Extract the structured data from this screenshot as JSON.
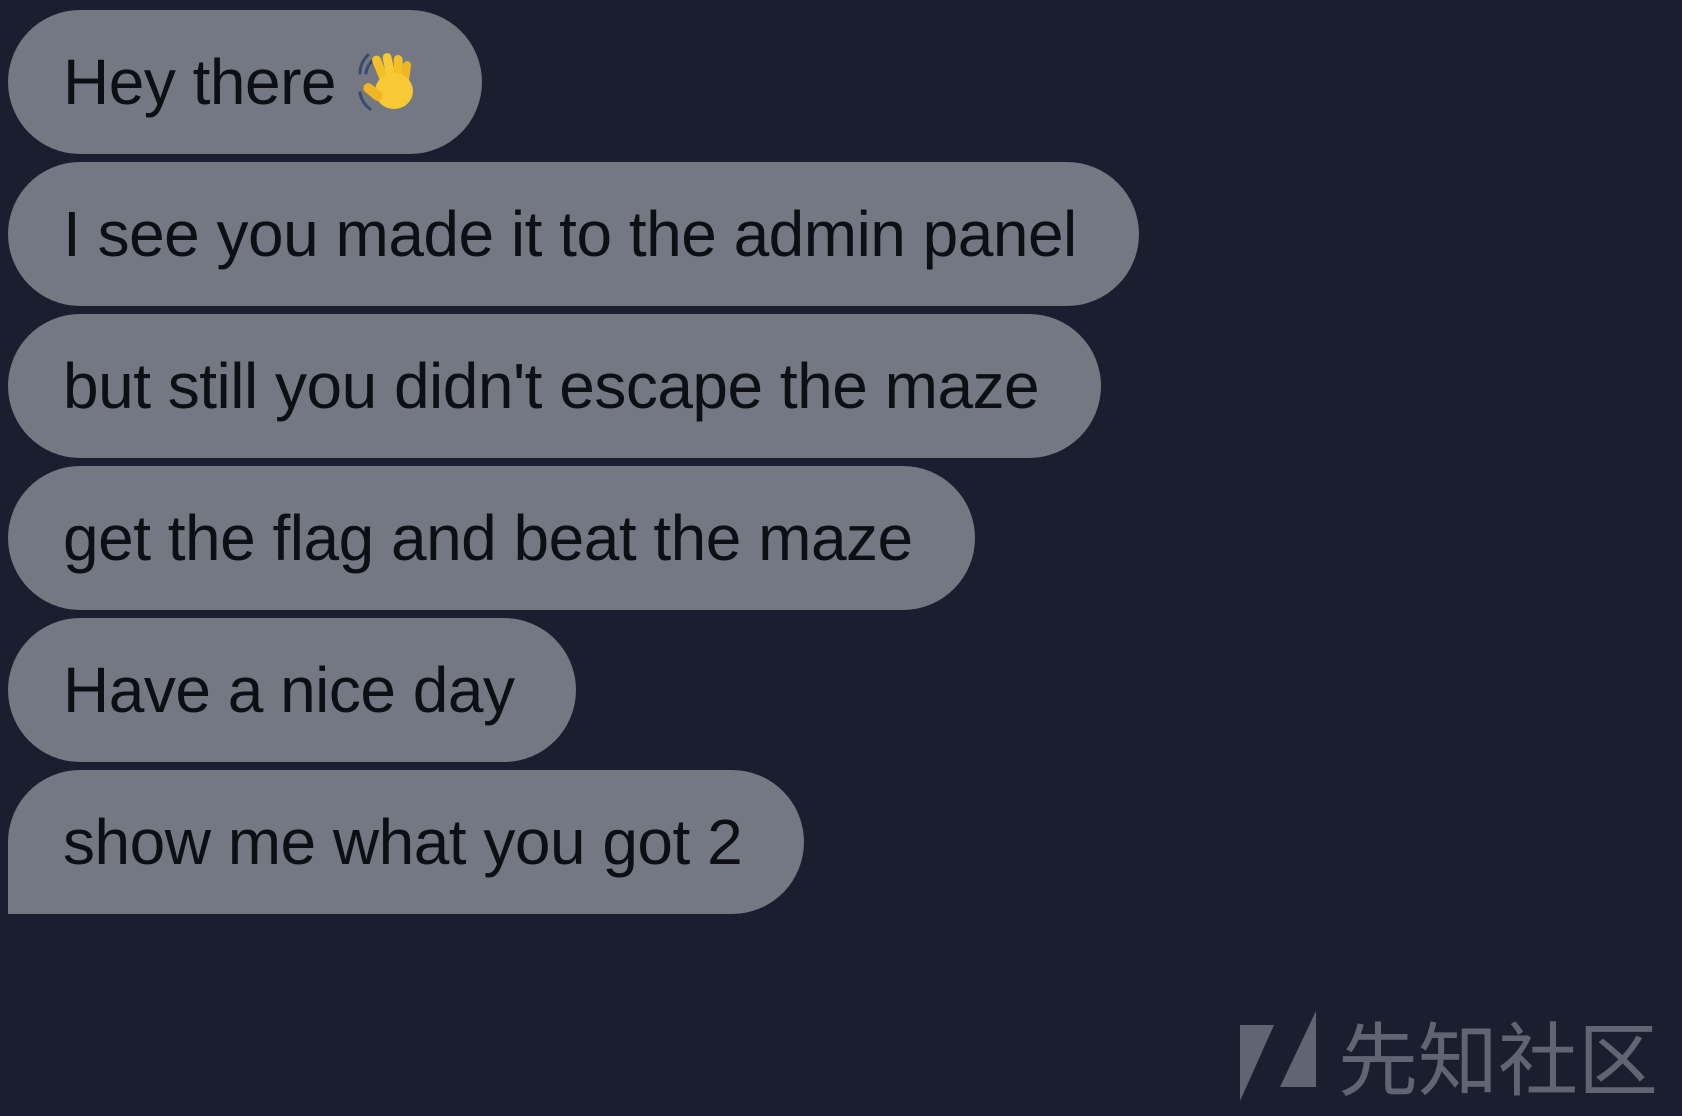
{
  "messages": [
    {
      "text": "Hey there",
      "emoji": "waving-hand-icon"
    },
    {
      "text": "I see you made it to the admin panel"
    },
    {
      "text": "but still you didn't escape the maze"
    },
    {
      "text": "get the flag and beat the maze"
    },
    {
      "text": "Have a nice day"
    },
    {
      "text": "show me what you got 2"
    }
  ],
  "watermark": {
    "text": "先知社区",
    "icon": "xianzhi-logo-icon"
  },
  "colors": {
    "background": "#1a1e2f",
    "bubble": "#737883",
    "text": "#0d0f15"
  }
}
